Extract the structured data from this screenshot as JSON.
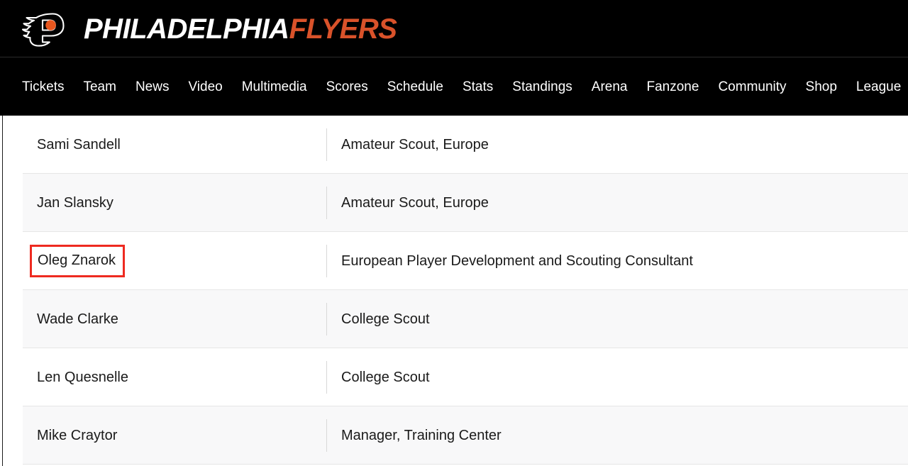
{
  "masthead": {
    "logo_icon": "flyers-winged-p-logo",
    "wordmark_city": "PHILADELPHIA",
    "wordmark_team": "FLYERS",
    "colors": {
      "background": "#000000",
      "city_text": "#ffffff",
      "team_text": "#d9522a"
    }
  },
  "nav": {
    "items": [
      {
        "label": "Tickets"
      },
      {
        "label": "Team"
      },
      {
        "label": "News"
      },
      {
        "label": "Video"
      },
      {
        "label": "Multimedia"
      },
      {
        "label": "Scores"
      },
      {
        "label": "Schedule"
      },
      {
        "label": "Stats"
      },
      {
        "label": "Standings"
      },
      {
        "label": "Arena"
      },
      {
        "label": "Fanzone"
      },
      {
        "label": "Community"
      },
      {
        "label": "Shop"
      },
      {
        "label": "League"
      }
    ]
  },
  "staff_table": {
    "highlight_color": "#ee2a20",
    "row_alt_background": "#f8f8f9",
    "rows": [
      {
        "name": "Sami Sandell",
        "title": "Amateur Scout, Europe",
        "highlighted": false
      },
      {
        "name": "Jan Slansky",
        "title": "Amateur Scout, Europe",
        "highlighted": false
      },
      {
        "name": "Oleg Znarok",
        "title": "European Player Development and Scouting Consultant",
        "highlighted": true
      },
      {
        "name": "Wade Clarke",
        "title": "College Scout",
        "highlighted": false
      },
      {
        "name": "Len Quesnelle",
        "title": "College Scout",
        "highlighted": false
      },
      {
        "name": "Mike Craytor",
        "title": "Manager, Training Center",
        "highlighted": false
      }
    ]
  }
}
